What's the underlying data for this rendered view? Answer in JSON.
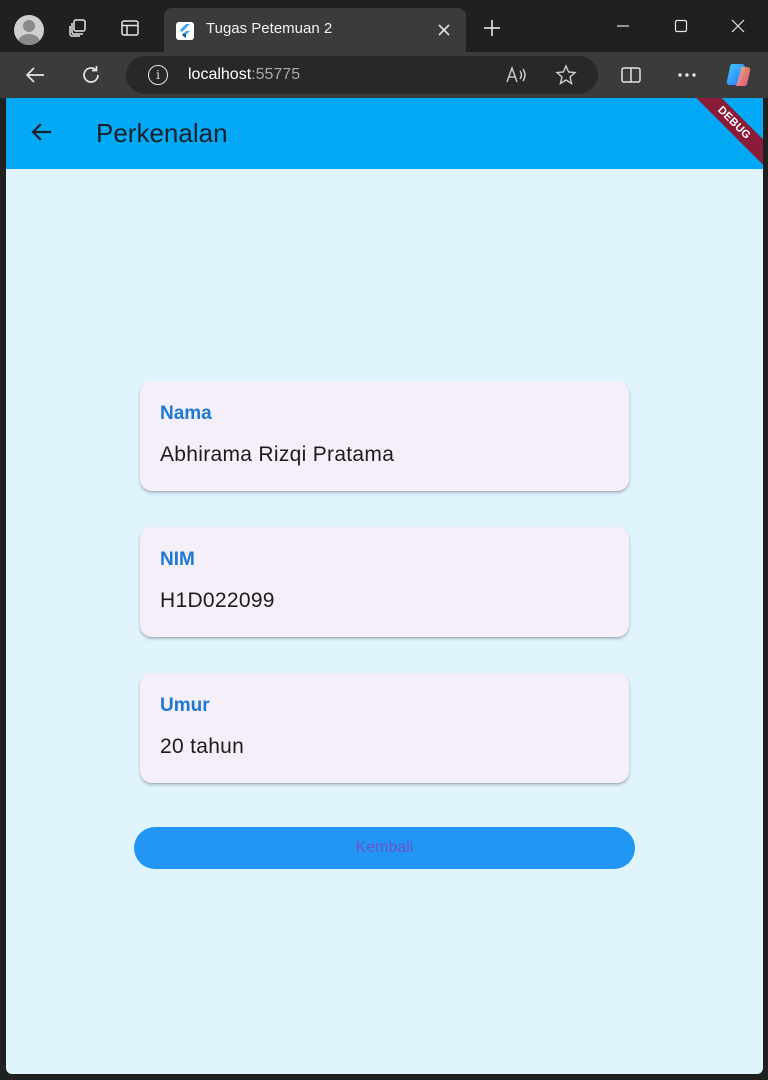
{
  "browser": {
    "tab": {
      "title": "Tugas Petemuan 2"
    },
    "address": {
      "host": "localhost",
      "port": ":55775"
    },
    "icons": {
      "profile": "profile-avatar-icon",
      "workspaces": "workspaces-icon",
      "tab_actions": "tab-actions-icon",
      "tab_favicon": "flutter-logo-icon",
      "tab_close": "close-icon",
      "new_tab": "plus-icon",
      "minimize": "minimize-icon",
      "maximize": "maximize-icon",
      "close_window": "close-icon",
      "back": "arrow-left-icon",
      "refresh": "refresh-icon",
      "site_info": "info-icon",
      "read_aloud": "read-aloud-icon",
      "favorite": "star-icon",
      "split_screen": "split-screen-icon",
      "more": "more-horizontal-icon",
      "copilot": "copilot-icon"
    }
  },
  "app": {
    "appbar": {
      "title": "Perkenalan",
      "back_icon": "arrow-left-icon",
      "debug_label": "DEBUG"
    },
    "cards": [
      {
        "label": "Nama",
        "value": "Abhirama Rizqi Pratama"
      },
      {
        "label": "NIM",
        "value": "H1D022099"
      },
      {
        "label": "Umur",
        "value": "20 tahun"
      }
    ],
    "button": {
      "label": "Kembali"
    }
  },
  "colors": {
    "appbar": "#03a9f4",
    "page_background": "#e0f4fd",
    "card_background": "#f4eff8",
    "card_label": "#1f78d1",
    "button_background": "#2196f3",
    "button_text": "#6b55c9",
    "debug_banner": "#8a1c39"
  }
}
